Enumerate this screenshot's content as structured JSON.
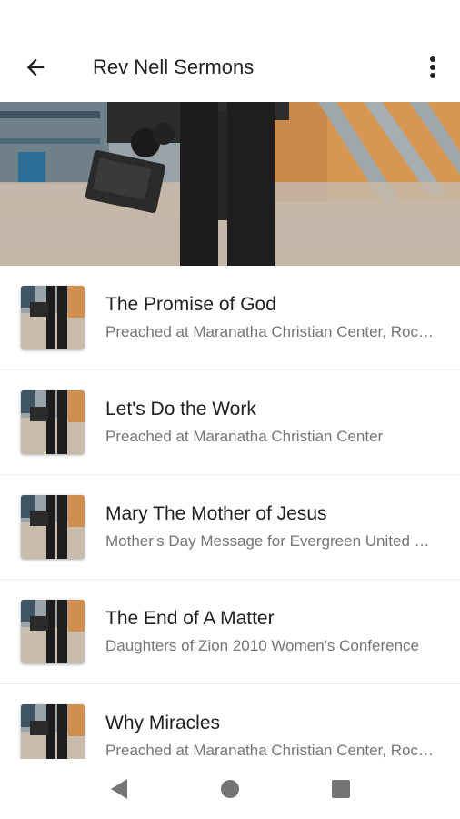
{
  "app_bar": {
    "title": "Rev Nell Sermons",
    "back_icon": "arrow-back-icon",
    "menu_icon": "more-vert-icon"
  },
  "hero": {
    "image": "person-holding-camera-walking"
  },
  "sermons": [
    {
      "title": "The Promise of God",
      "subtitle": "Preached at Maranatha Christian Center, Rochester, NY"
    },
    {
      "title": "Let's Do the Work",
      "subtitle": "Preached at Maranatha Christian Center"
    },
    {
      "title": "Mary The Mother of Jesus",
      "subtitle": "Mother's Day Message for Evergreen United Methodist Church"
    },
    {
      "title": "The End of A Matter",
      "subtitle": "Daughters of Zion 2010 Women's Conference"
    },
    {
      "title": "Why Miracles",
      "subtitle": "Preached at Maranatha Christian Center, Rochester, NY"
    }
  ],
  "nav": {
    "back_icon": "nav-back-triangle-icon",
    "home_icon": "nav-home-circle-icon",
    "recents_icon": "nav-recents-square-icon"
  },
  "colors": {
    "text_primary": "#212121",
    "text_secondary": "#757575",
    "nav_icon": "#757575"
  }
}
